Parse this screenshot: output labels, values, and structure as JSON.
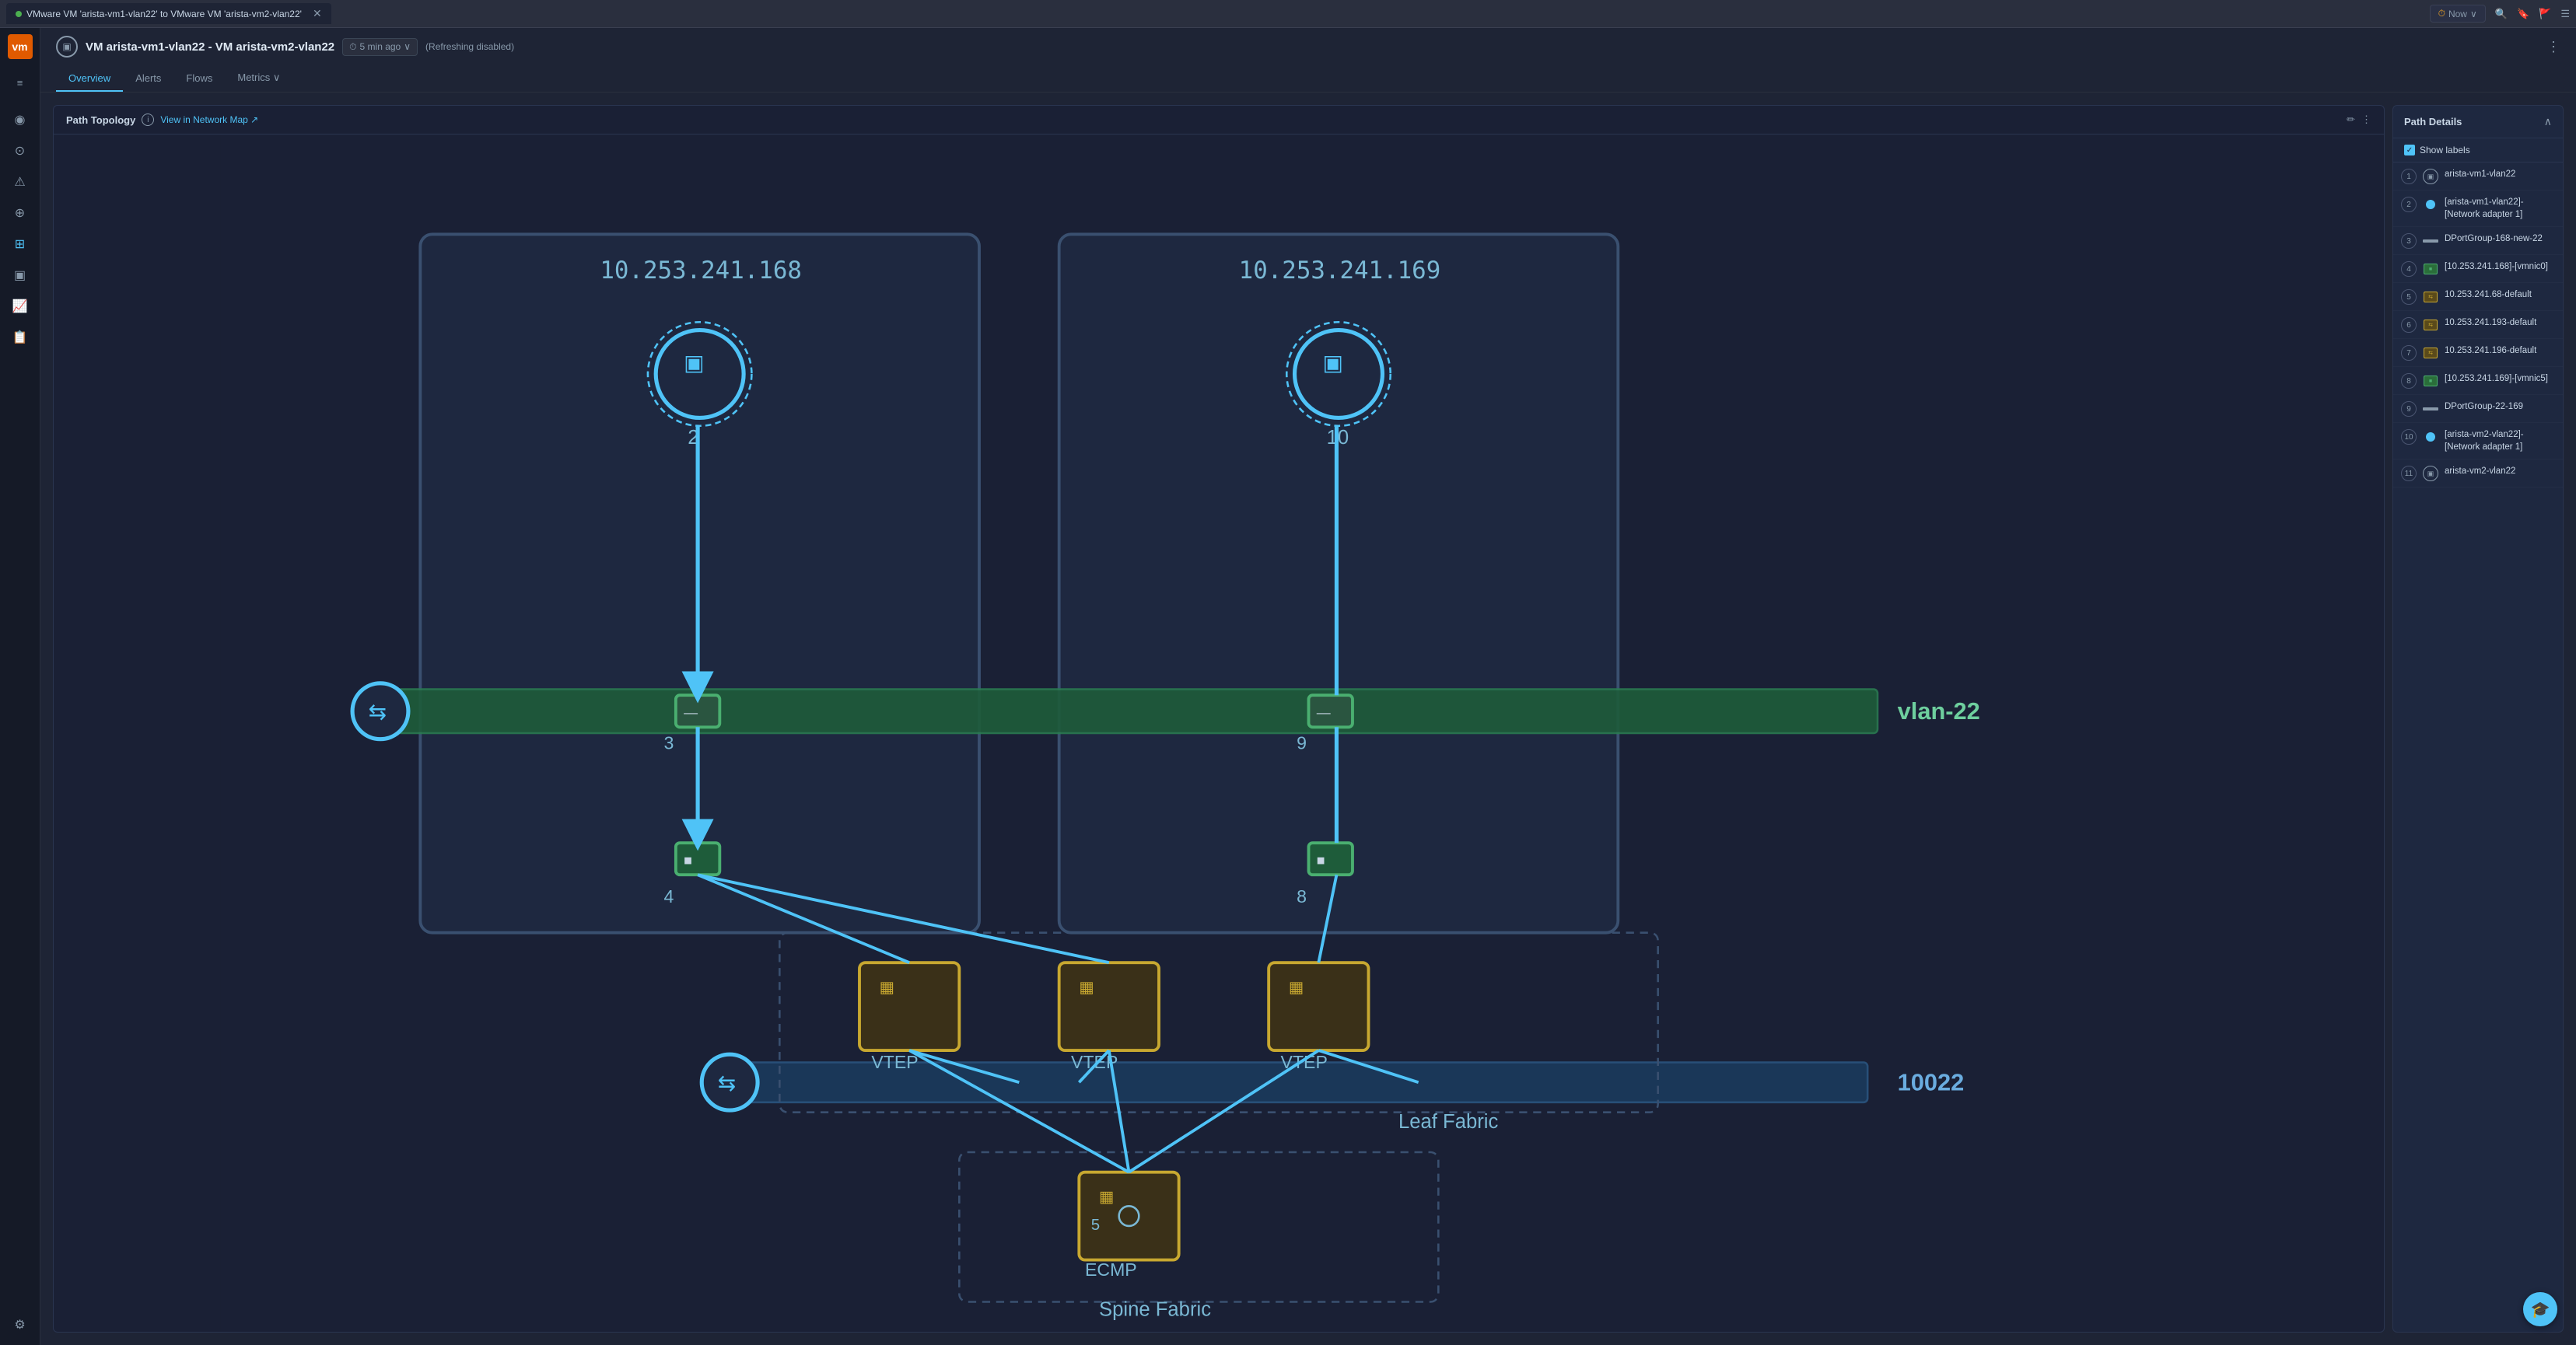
{
  "browser": {
    "tab_text": "VMware VM 'arista-vm1-vlan22' to VMware VM 'arista-vm2-vlan22'",
    "time_label": "Now",
    "search_icon": "🔍",
    "bookmark_icon": "🔖",
    "flag_icon": "🚩",
    "menu_icon": "☰",
    "close_icon": "✕"
  },
  "header": {
    "vm_icon": "▣",
    "title": "VM arista-vm1-vlan22 - VM arista-vm2-vlan22",
    "time_ago": "5 min ago",
    "refresh_status": "(Refreshing  disabled)",
    "more_icon": "⋮",
    "tabs": [
      {
        "label": "Overview",
        "active": true
      },
      {
        "label": "Alerts",
        "active": false
      },
      {
        "label": "Flows",
        "active": false
      },
      {
        "label": "Metrics ∨",
        "active": false
      }
    ]
  },
  "topology": {
    "panel_title": "Path Topology",
    "network_map_link": "View in Network Map ↗",
    "info_icon": "i",
    "edit_icon": "✏",
    "more_icon": "⋮",
    "nodes": {
      "host1_ip": "10.253.241.168",
      "host2_ip": "10.253.241.169",
      "vlan_label": "vlan-22",
      "vxlan_label": "10022",
      "vtep1_label": "VTEP",
      "vtep2_label": "VTEP",
      "vtep3_label": "VTEP",
      "leaf_fabric_label": "Leaf Fabric",
      "ecmp_label": "ECMP",
      "spine_fabric_label": "Spine Fabric"
    }
  },
  "path_details": {
    "title": "Path Details",
    "show_labels": "Show labels",
    "collapse_icon": "∧",
    "items": [
      {
        "num": "1",
        "icon_type": "vm",
        "label": "arista-vm1-vlan22"
      },
      {
        "num": "2",
        "icon_type": "dot",
        "label": "[arista-vm1-vlan22]-[Network adapter 1]"
      },
      {
        "num": "3",
        "icon_type": "port",
        "label": "DPortGroup-168-new-22"
      },
      {
        "num": "4",
        "icon_type": "vmnic-green",
        "label": "[10.253.241.168]-[vmnic0]"
      },
      {
        "num": "5",
        "icon_type": "switch",
        "label": "10.253.241.68-default"
      },
      {
        "num": "6",
        "icon_type": "switch",
        "label": "10.253.241.193-default"
      },
      {
        "num": "7",
        "icon_type": "switch",
        "label": "10.253.241.196-default"
      },
      {
        "num": "8",
        "icon_type": "vmnic-green",
        "label": "[10.253.241.169]-[vmnic5]"
      },
      {
        "num": "9",
        "icon_type": "port",
        "label": "DPortGroup-22-169"
      },
      {
        "num": "10",
        "icon_type": "dot",
        "label": "[arista-vm2-vlan22]-[Network adapter 1]"
      },
      {
        "num": "11",
        "icon_type": "vm",
        "label": "arista-vm2-vlan22"
      }
    ]
  },
  "sidebar": {
    "logo": "vm",
    "items": [
      {
        "icon": "≡",
        "name": "expand",
        "active": false
      },
      {
        "icon": "◎",
        "name": "dashboard",
        "active": false
      },
      {
        "icon": "⊙",
        "name": "alerts",
        "active": false
      },
      {
        "icon": "⚠",
        "name": "warnings",
        "active": false
      },
      {
        "icon": "⊕",
        "name": "network",
        "active": false
      },
      {
        "icon": "⊞",
        "name": "topology",
        "active": true
      },
      {
        "icon": "▣",
        "name": "virtual",
        "active": false
      },
      {
        "icon": "📊",
        "name": "analytics",
        "active": false
      },
      {
        "icon": "☰",
        "name": "reports",
        "active": false
      },
      {
        "icon": "⚙",
        "name": "settings",
        "active": false
      }
    ]
  }
}
